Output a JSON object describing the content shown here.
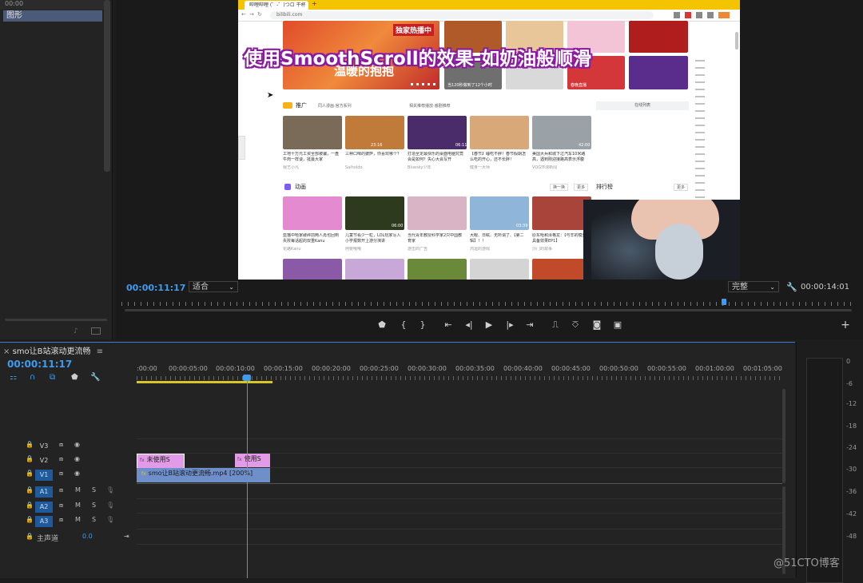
{
  "project": {
    "ruler_label": "00:00",
    "bin_item": "图形"
  },
  "browser": {
    "tab_label": "哔哩哔哩 (゜-゜)つロ 干杯",
    "url": "bilibili.com"
  },
  "overlay_title": "使用SmoothScroll的效果-如奶油般顺滑",
  "page_content": {
    "hero_caption": "温暖的抱抱",
    "hero_badge": "独家热播中",
    "promo_section": "推广",
    "promo_links": [
      "同人漫画·官方系列",
      "相关推荐播放·番剧推荐"
    ],
    "online_list_button": "在线列表",
    "promo_cards": [
      {
        "title": "工地十万元工资全部被骗，一盘牛肉一样谈，挺最大家",
        "author": "我艺小凡"
      },
      {
        "title": "三种口味的披萨，你喜欢哪个？",
        "author": "Salholdo"
      },
      {
        "title": "打造全定最快乐的桌面电脑究竟会是如何？失心大会写开",
        "author": "Bluesky少年"
      },
      {
        "title": "【春节】睡吃不胖！春节假期怎么吃的开心，还不长胖！",
        "author": "健身一大师"
      },
      {
        "title": "美国大兵和城下过汽车10米路高，遇到刚迎接路高表示浮腹",
        "author": "VOG环球新闻"
      }
    ],
    "anime_section": "动画",
    "anime_controls": [
      "换一换",
      "更多"
    ],
    "ranking_label": "排行榜",
    "ranking_more": "更多",
    "anime_cards": [
      {
        "title": "蓝猫中哈家破碎前两人再也回到失败每话起的双重Kanu",
        "author": "花路Kanu"
      },
      {
        "title": "儿童节看少一粒，LOL玩家写入小学报数开上游分演讲",
        "author": "阿要哦哦"
      },
      {
        "title": "当代青年教授科学家2只中国教育家",
        "author": "游击的广告"
      },
      {
        "title": "大眼、日眩、无所谓了、【第二辑】！！",
        "author": "鸿运的游戏"
      },
      {
        "title": "原东哈和泽格龙：【与羊的模型具备效果EP1】",
        "author": "沙门的故事"
      }
    ],
    "thumb_durations": [
      "23:16",
      "06:11",
      "42:00",
      "06:00",
      "03:39"
    ],
    "hero_small_captions": [
      "当120秒做到了12个小时",
      "春晚直播"
    ]
  },
  "program_monitor": {
    "current_timecode": "00:00:11:17",
    "fit_option": "适合",
    "quality_option": "完整",
    "duration_timecode": "00:00:14:01"
  },
  "transport_icons": [
    "marker-icon",
    "mark-in-icon",
    "mark-out-icon",
    "go-to-in-icon",
    "step-back-icon",
    "play-icon",
    "step-forward-icon",
    "go-to-out-icon",
    "lift-icon",
    "extract-icon",
    "export-frame-icon",
    "compare-icon",
    "add-button-icon"
  ],
  "timeline": {
    "sequence_name": "smo让B站滚动更流畅",
    "current_timecode": "00:00:11:17",
    "ruler_labels": [
      ":00:00",
      "00:00:05:00",
      "00:00:10:00",
      "00:00:15:00",
      "00:00:20:00",
      "00:00:25:00",
      "00:00:30:00",
      "00:00:35:00",
      "00:00:40:00",
      "00:00:45:00",
      "00:00:50:00",
      "00:00:55:00",
      "00:01:00:00",
      "00:01:05:00"
    ],
    "tracks": [
      {
        "name": "V3",
        "type": "video",
        "targeted": false
      },
      {
        "name": "V2",
        "type": "video",
        "targeted": false
      },
      {
        "name": "V1",
        "type": "video",
        "targeted": true
      },
      {
        "name": "A1",
        "type": "audio",
        "targeted": true
      },
      {
        "name": "A2",
        "type": "audio",
        "targeted": true
      },
      {
        "name": "A3",
        "type": "audio",
        "targeted": true
      }
    ],
    "audio_buttons": [
      "M",
      "S"
    ],
    "master_label": "主声道",
    "master_value": "0.0",
    "clips": {
      "v2_first": "未使用S",
      "v2_second": "使用S",
      "v1_main": "smo让B站滚动更流畅.mp4 [200%]"
    }
  },
  "audio_meter": {
    "db_labels": [
      "0",
      "-6",
      "-12",
      "-18",
      "-24",
      "-30",
      "-36",
      "-42",
      "-48"
    ]
  },
  "watermark": "@51CTO博客",
  "colors": {
    "accent_blue": "#3d9bf0",
    "clip_pink": "#e29be6",
    "clip_blue": "#6f8fca",
    "work_bar": "#d6c626",
    "browser_tabbar": "#f4c400"
  }
}
